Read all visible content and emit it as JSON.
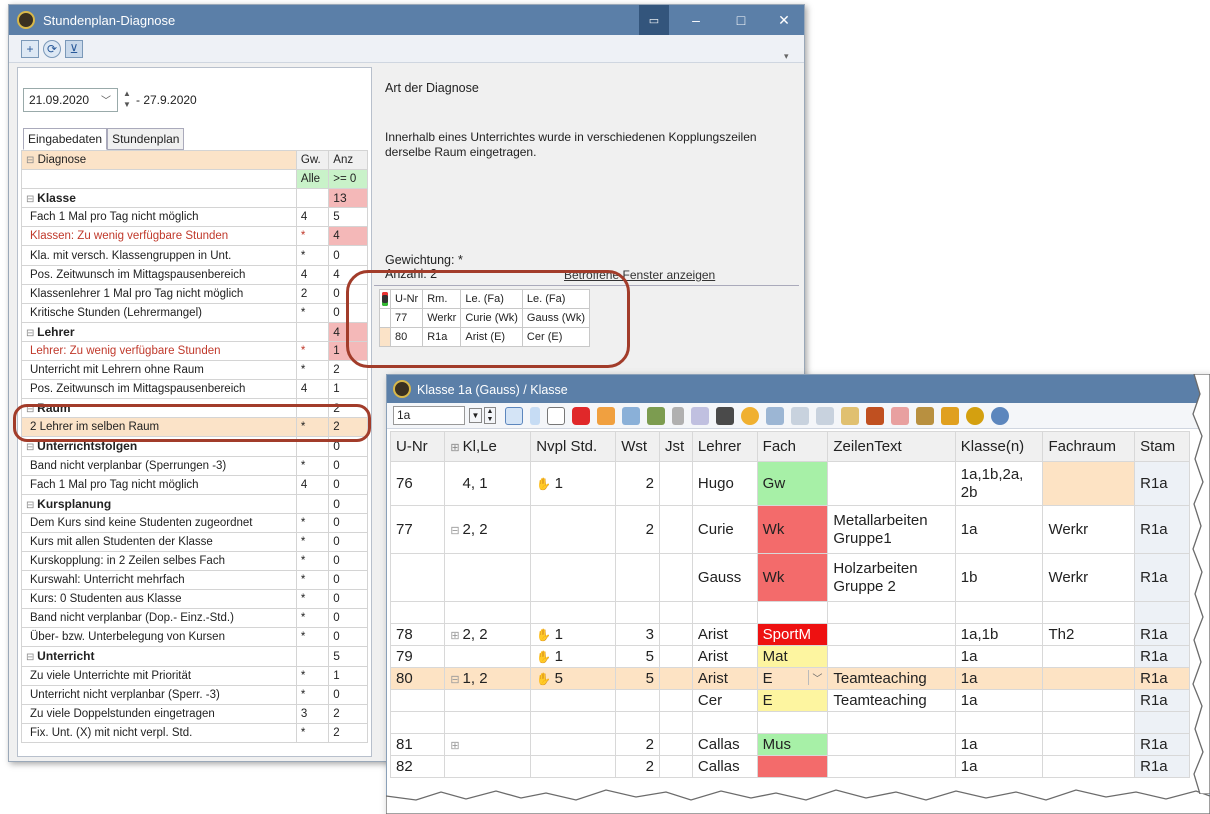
{
  "main_window": {
    "title": "Stundenplan-Diagnose",
    "buttons": {
      "restore": "▭",
      "minimize": "–",
      "maximize": "□",
      "close": "✕"
    },
    "toolbar": [
      "expand-icon",
      "refresh-icon",
      "filter-icon"
    ]
  },
  "date": {
    "value": "21.09.2020",
    "range_end": "- 27.9.2020"
  },
  "tabs": [
    "Eingabedaten",
    "Stundenplan"
  ],
  "diag_table": {
    "headers": {
      "c1": "Diagnose",
      "c2": "Gw.",
      "c3": "Anz"
    },
    "subhdr": {
      "c2": "Alle",
      "c3": ">= 0"
    },
    "rows": [
      {
        "label": "Klasse",
        "gw": "",
        "anz": "13",
        "type": "group",
        "anz_pink": true
      },
      {
        "label": "Fach 1 Mal pro Tag nicht möglich",
        "gw": "4",
        "anz": "5"
      },
      {
        "label": "Klassen: Zu wenig verfügbare Stunden",
        "gw": "*",
        "anz": "4",
        "red": true,
        "anz_pink": true
      },
      {
        "label": "Kla. mit versch. Klassengruppen in Unt.",
        "gw": "*",
        "anz": "0"
      },
      {
        "label": "Pos. Zeitwunsch im Mittagspausenbereich",
        "gw": "4",
        "anz": "4"
      },
      {
        "label": "Klassenlehrer 1 Mal pro Tag nicht möglich",
        "gw": "2",
        "anz": "0"
      },
      {
        "label": "Kritische Stunden (Lehrermangel)",
        "gw": "*",
        "anz": "0"
      },
      {
        "label": "Lehrer",
        "gw": "",
        "anz": "4",
        "type": "group",
        "anz_pink": true
      },
      {
        "label": "Lehrer: Zu wenig verfügbare Stunden",
        "gw": "*",
        "anz": "1",
        "red": true,
        "anz_pink": true
      },
      {
        "label": "Unterricht mit Lehrern ohne Raum",
        "gw": "*",
        "anz": "2"
      },
      {
        "label": "Pos. Zeitwunsch im Mittagspausenbereich",
        "gw": "4",
        "anz": "1"
      },
      {
        "label": "Raum",
        "gw": "",
        "anz": "2",
        "type": "group"
      },
      {
        "label": "2 Lehrer im selben Raum",
        "gw": "*",
        "anz": "2",
        "selected": true
      },
      {
        "label": "Unterrichtsfolgen",
        "gw": "",
        "anz": "0",
        "type": "group"
      },
      {
        "label": "Band nicht verplanbar (Sperrungen -3)",
        "gw": "*",
        "anz": "0"
      },
      {
        "label": "Fach 1 Mal pro Tag nicht möglich",
        "gw": "4",
        "anz": "0"
      },
      {
        "label": "Kursplanung",
        "gw": "",
        "anz": "0",
        "type": "group"
      },
      {
        "label": "Dem Kurs sind keine Studenten zugeordnet",
        "gw": "*",
        "anz": "0"
      },
      {
        "label": "Kurs mit allen Studenten der Klasse",
        "gw": "*",
        "anz": "0"
      },
      {
        "label": "Kurskopplung: in 2 Zeilen selbes Fach",
        "gw": "*",
        "anz": "0"
      },
      {
        "label": "Kurswahl: Unterricht mehrfach",
        "gw": "*",
        "anz": "0"
      },
      {
        "label": "Kurs: 0 Studenten aus Klasse",
        "gw": "*",
        "anz": "0"
      },
      {
        "label": "Band nicht verplanbar (Dop.- Einz.-Std.)",
        "gw": "*",
        "anz": "0"
      },
      {
        "label": "Über- bzw. Unterbelegung von Kursen",
        "gw": "*",
        "anz": "0"
      },
      {
        "label": "Unterricht",
        "gw": "",
        "anz": "5",
        "type": "group"
      },
      {
        "label": "Zu viele Unterrichte mit Priorität",
        "gw": "*",
        "anz": "1"
      },
      {
        "label": "Unterricht nicht verplanbar (Sperr. -3)",
        "gw": "*",
        "anz": "0"
      },
      {
        "label": "Zu viele Doppelstunden eingetragen",
        "gw": "3",
        "anz": "2"
      },
      {
        "label": "Fix. Unt. (X) mit nicht verpl. Std.",
        "gw": "*",
        "anz": "2"
      }
    ]
  },
  "info": {
    "heading": "Art der Diagnose",
    "description": "Innerhalb eines Unterrichtes wurde in verschiedenen Kopplungszeilen derselbe Raum eingetragen.",
    "weight": "Gewichtung: *",
    "count": "Anzahl: 2",
    "link": "Betroffene Fenster anzeigen"
  },
  "mini_table": {
    "headers": [
      "U-Nr",
      "Rm.",
      "Le. (Fa)",
      "Le. (Fa)"
    ],
    "rows": [
      [
        "77",
        "Werkr",
        "Curie (Wk)",
        "Gauss (Wk)"
      ],
      [
        "80",
        "R1a",
        "Arist (E)",
        "Cer (E)"
      ]
    ]
  },
  "class_window": {
    "title": "Klasse 1a (Gauss) / Klasse",
    "selector": "1a",
    "headers": [
      "U-Nr",
      "Kl,Le",
      "Nvpl Std.",
      "Wst",
      "Jst",
      "Lehrer",
      "Fach",
      "ZeilenText",
      "Klasse(n)",
      "Fachraum",
      "Stam"
    ],
    "rows": [
      {
        "unr": "76",
        "klle": "4, 1",
        "nvpl": "1",
        "wst": "2",
        "jst": "",
        "lehrer": "Hugo",
        "fach": "Gw",
        "fachcls": "c-green",
        "zeile": "",
        "klassen": "1a,1b,2a, 2b",
        "fachraum": "",
        "fachraum_peach": true,
        "stam": "R1a",
        "h": 44
      },
      {
        "unr": "77",
        "klle": "2, 2",
        "nvpl": "",
        "wst": "2",
        "jst": "",
        "lehrer": "Curie",
        "fach": "Wk",
        "fachcls": "c-red",
        "zeile": "Metallarbeiten Gruppe1",
        "klassen": "1a",
        "fachraum": "Werkr",
        "stam": "R1a",
        "h": 48
      },
      {
        "unr": "",
        "klle": "",
        "nvpl": "",
        "wst": "",
        "jst": "",
        "lehrer": "Gauss",
        "fach": "Wk",
        "fachcls": "c-red",
        "zeile": "Holzarbeiten Gruppe 2",
        "klassen": "1b",
        "fachraum": "Werkr",
        "stam": "R1a",
        "h": 48
      },
      {
        "unr": "",
        "klle": "",
        "nvpl": "",
        "wst": "",
        "jst": "",
        "lehrer": "",
        "fach": "",
        "fachcls": "",
        "zeile": "",
        "klassen": "",
        "fachraum": "",
        "stam": "",
        "h": 22
      },
      {
        "unr": "78",
        "klle": "2, 2",
        "nvpl": "1",
        "wst": "3",
        "jst": "",
        "lehrer": "Arist",
        "fach": "SportM",
        "fachcls": "c-bright",
        "zeile": "",
        "klassen": "1a,1b",
        "fachraum": "Th2",
        "stam": "R1a",
        "h": 22
      },
      {
        "unr": "79",
        "klle": "",
        "nvpl": "1",
        "wst": "5",
        "jst": "",
        "lehrer": "Arist",
        "fach": "Mat",
        "fachcls": "c-yellow",
        "zeile": "",
        "klassen": "1a",
        "fachraum": "",
        "stam": "R1a",
        "h": 22
      },
      {
        "unr": "80",
        "klle": "1, 2",
        "nvpl": "5",
        "wst": "5",
        "jst": "",
        "lehrer": "Arist",
        "fach": "E",
        "fachcls": "c-yellow",
        "zeile": "Teamteaching",
        "klassen": "1a",
        "fachraum": "",
        "stam": "R1a",
        "h": 22,
        "selected": true
      },
      {
        "unr": "",
        "klle": "",
        "nvpl": "",
        "wst": "",
        "jst": "",
        "lehrer": "Cer",
        "fach": "E",
        "fachcls": "c-yellow",
        "zeile": "Teamteaching",
        "klassen": "1a",
        "fachraum": "",
        "stam": "R1a",
        "h": 22
      },
      {
        "unr": "",
        "klle": "",
        "nvpl": "",
        "wst": "",
        "jst": "",
        "lehrer": "",
        "fach": "",
        "fachcls": "",
        "zeile": "",
        "klassen": "",
        "fachraum": "",
        "stam": "",
        "h": 22
      },
      {
        "unr": "81",
        "klle": "",
        "nvpl": "",
        "wst": "2",
        "jst": "",
        "lehrer": "Callas",
        "fach": "Mus",
        "fachcls": "c-green",
        "zeile": "",
        "klassen": "1a",
        "fachraum": "",
        "stam": "R1a",
        "h": 22
      },
      {
        "unr": "82",
        "klle": "",
        "nvpl": "",
        "wst": "2",
        "jst": "",
        "lehrer": "Callas",
        "fach": "",
        "fachcls": "c-red",
        "zeile": "",
        "klassen": "1a",
        "fachraum": "",
        "stam": "R1a",
        "h": 22
      }
    ]
  }
}
